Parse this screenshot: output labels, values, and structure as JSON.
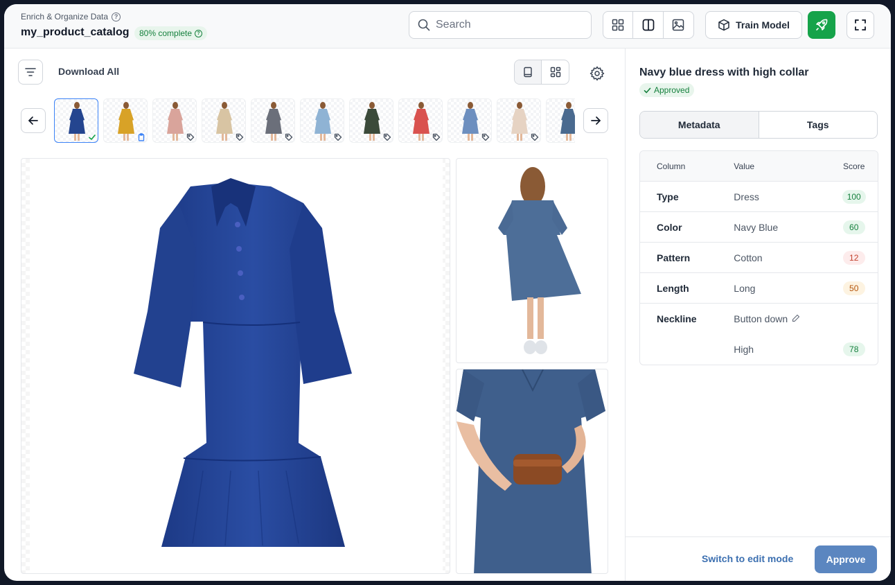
{
  "header": {
    "breadcrumb": "Enrich & Organize Data",
    "dataset_name": "my_product_catalog",
    "progress": "80% complete",
    "progress_fraction": 0.8,
    "search": {
      "placeholder": "Search"
    },
    "view_buttons": [
      "grid-view-icon",
      "split-view-icon",
      "image-view-icon"
    ],
    "train_model_label": "Train Model",
    "deploy_icon": "rocket-icon",
    "fullscreen_icon": "expand-icon"
  },
  "toolbar": {
    "filter_icon": "filter-icon",
    "download_all": "Download All",
    "layout_options": [
      "single-image-icon",
      "grid-images-icon"
    ],
    "settings_icon": "gear-icon"
  },
  "thumbnails": [
    {
      "item": "navy blue dress",
      "color": "#24458f",
      "status": "approved"
    },
    {
      "item": "mustard dress",
      "color": "#d8a227",
      "status": "pending"
    },
    {
      "item": "pink jumpsuit",
      "color": "#d9a49b",
      "status": "tag"
    },
    {
      "item": "beige dress",
      "color": "#d8c4a3",
      "status": "tag"
    },
    {
      "item": "patterned dress",
      "color": "#6b6f7a",
      "status": "tag"
    },
    {
      "item": "light jeans",
      "color": "#8fb3d4",
      "status": "tag"
    },
    {
      "item": "floral maxi dress",
      "color": "#3b4a3a",
      "status": "tag"
    },
    {
      "item": "red patterned dress",
      "color": "#d9524f",
      "status": "tag"
    },
    {
      "item": "chambray dress",
      "color": "#6d8fbf",
      "status": "tag"
    },
    {
      "item": "beige skirt",
      "color": "#e6d3c3",
      "status": "tag"
    },
    {
      "item": "denim dress",
      "color": "#4a6a8f",
      "status": "tag"
    }
  ],
  "detail": {
    "title": "Navy blue dress with high collar",
    "status": "Approved",
    "tabs": [
      "Metadata",
      "Tags"
    ],
    "active_tab": "Metadata",
    "columns": {
      "column": "Column",
      "value": "Value",
      "score": "Score"
    },
    "rows": [
      {
        "column": "Type",
        "value": "Dress",
        "score": "100",
        "level": "high"
      },
      {
        "column": "Color",
        "value": "Navy Blue",
        "score": "60",
        "level": "high"
      },
      {
        "column": "Pattern",
        "value": "Cotton",
        "score": "12",
        "level": "low"
      },
      {
        "column": "Length",
        "value": "Long",
        "score": "50",
        "level": "mid"
      },
      {
        "column": "Neckline",
        "value": "Button down",
        "score": "",
        "level": "edit"
      },
      {
        "column": "",
        "value": "High",
        "score": "78",
        "level": "high"
      }
    ]
  },
  "footer": {
    "switch_edit": "Switch to edit mode",
    "approve": "Approve"
  },
  "colors": {
    "accent_green": "#16a34a",
    "approve_blue": "#5b86c0",
    "link_blue": "#3b6fb0",
    "score_high_bg": "#e6f6ec",
    "score_high_fg": "#15803d",
    "score_low_bg": "#fdecec",
    "score_low_fg": "#c2412d",
    "score_mid_bg": "#fdf3e1",
    "score_mid_fg": "#b45309"
  }
}
